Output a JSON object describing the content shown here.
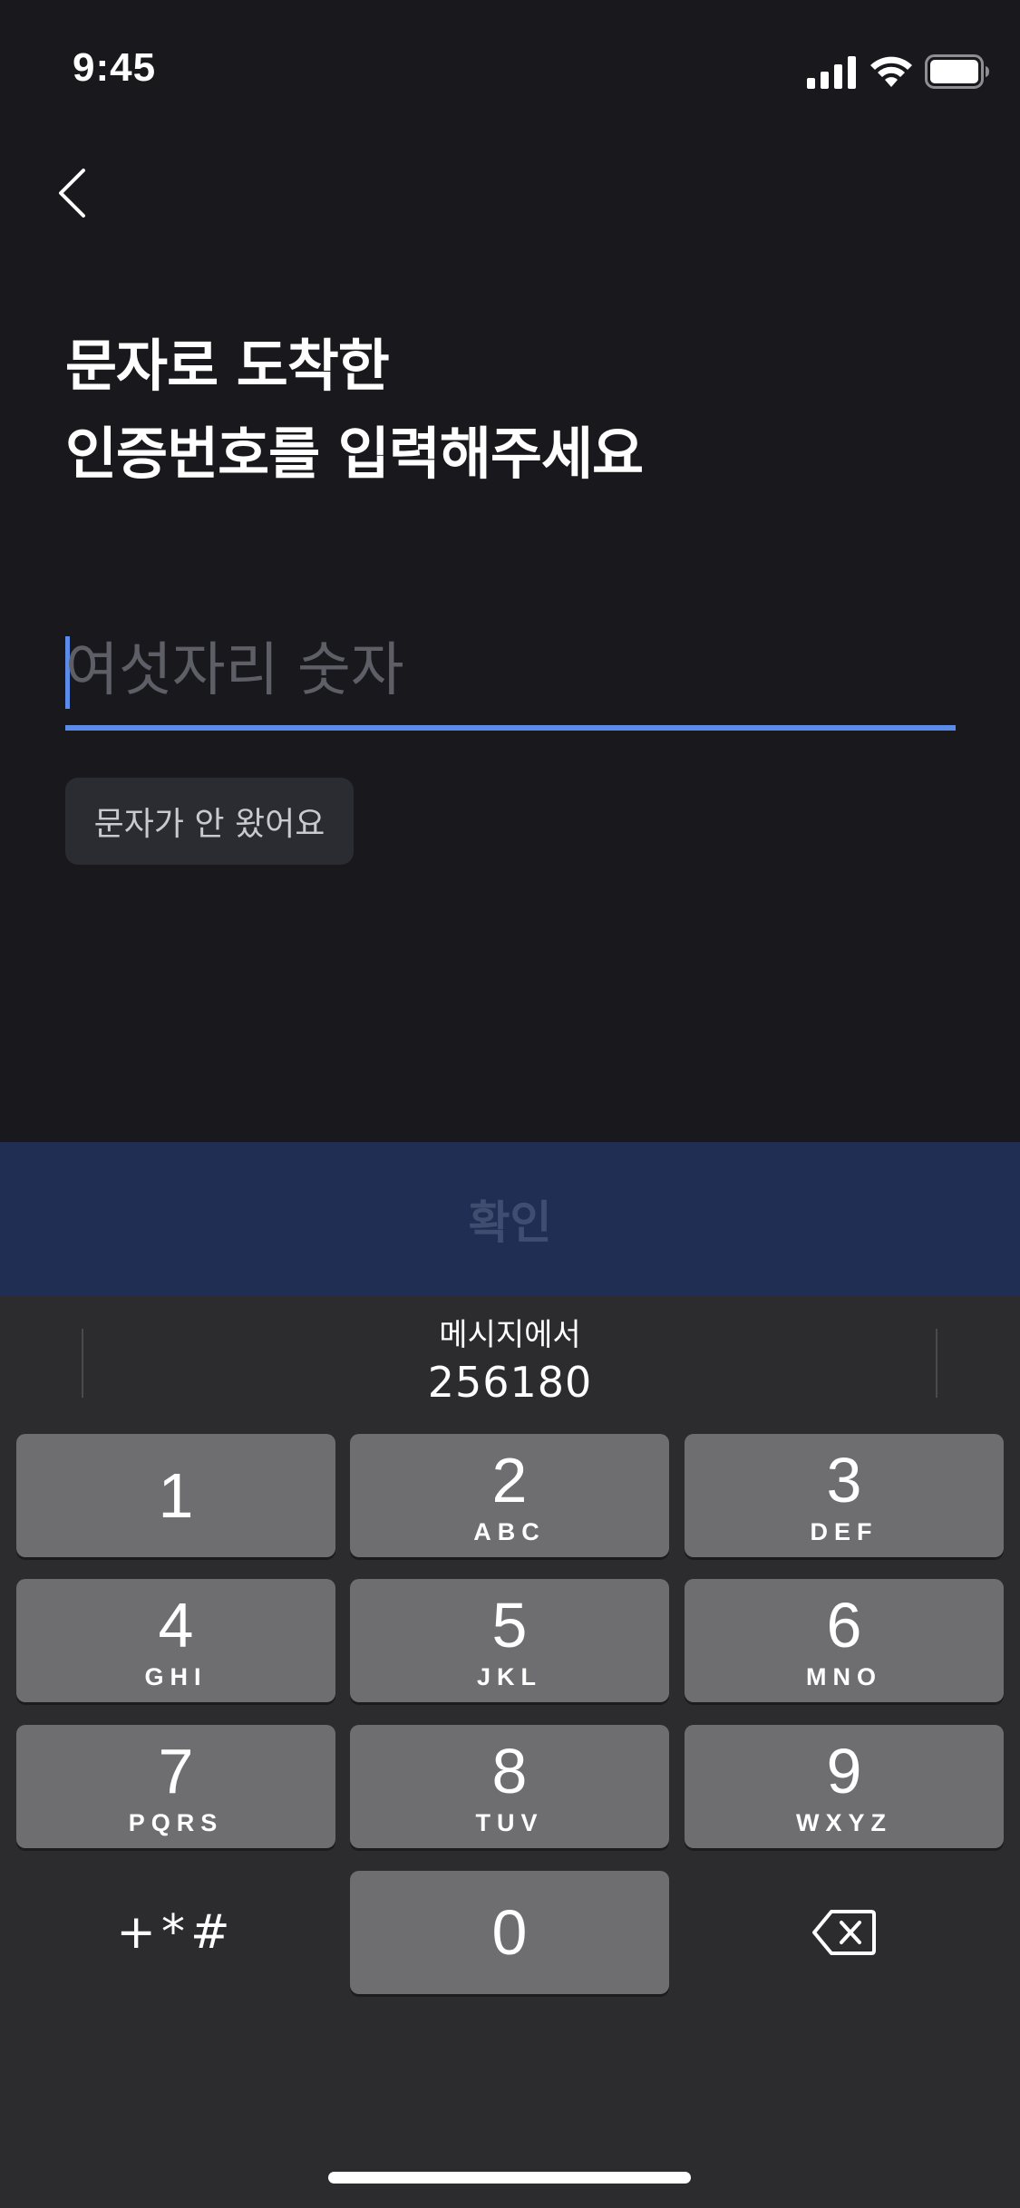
{
  "status_bar": {
    "time": "9:45"
  },
  "nav": {
    "back_icon": "chevron-left-icon"
  },
  "title": {
    "line1": "문자로 도착한",
    "line2": "인증번호를 입력해주세요"
  },
  "code_input": {
    "placeholder": "여섯자리 숫자",
    "value": ""
  },
  "resend_label": "문자가 안 왔어요",
  "confirm_label": "확인",
  "colors": {
    "accent": "#5b8ce9",
    "confirm_bg": "#1f2e52",
    "background": "#18181d",
    "keyboard_bg": "#2c2c2e",
    "key_bg": "#6e6e70"
  },
  "keyboard": {
    "suggestion": {
      "source": "메시지에서",
      "code": "256180"
    },
    "keys": [
      {
        "digit": "1",
        "letters": ""
      },
      {
        "digit": "2",
        "letters": "ABC"
      },
      {
        "digit": "3",
        "letters": "DEF"
      },
      {
        "digit": "4",
        "letters": "GHI"
      },
      {
        "digit": "5",
        "letters": "JKL"
      },
      {
        "digit": "6",
        "letters": "MNO"
      },
      {
        "digit": "7",
        "letters": "PQRS"
      },
      {
        "digit": "8",
        "letters": "TUV"
      },
      {
        "digit": "9",
        "letters": "WXYZ"
      },
      {
        "digit": "0",
        "letters": ""
      }
    ],
    "symbols_label": "+*#",
    "delete_icon": "backspace-icon"
  }
}
